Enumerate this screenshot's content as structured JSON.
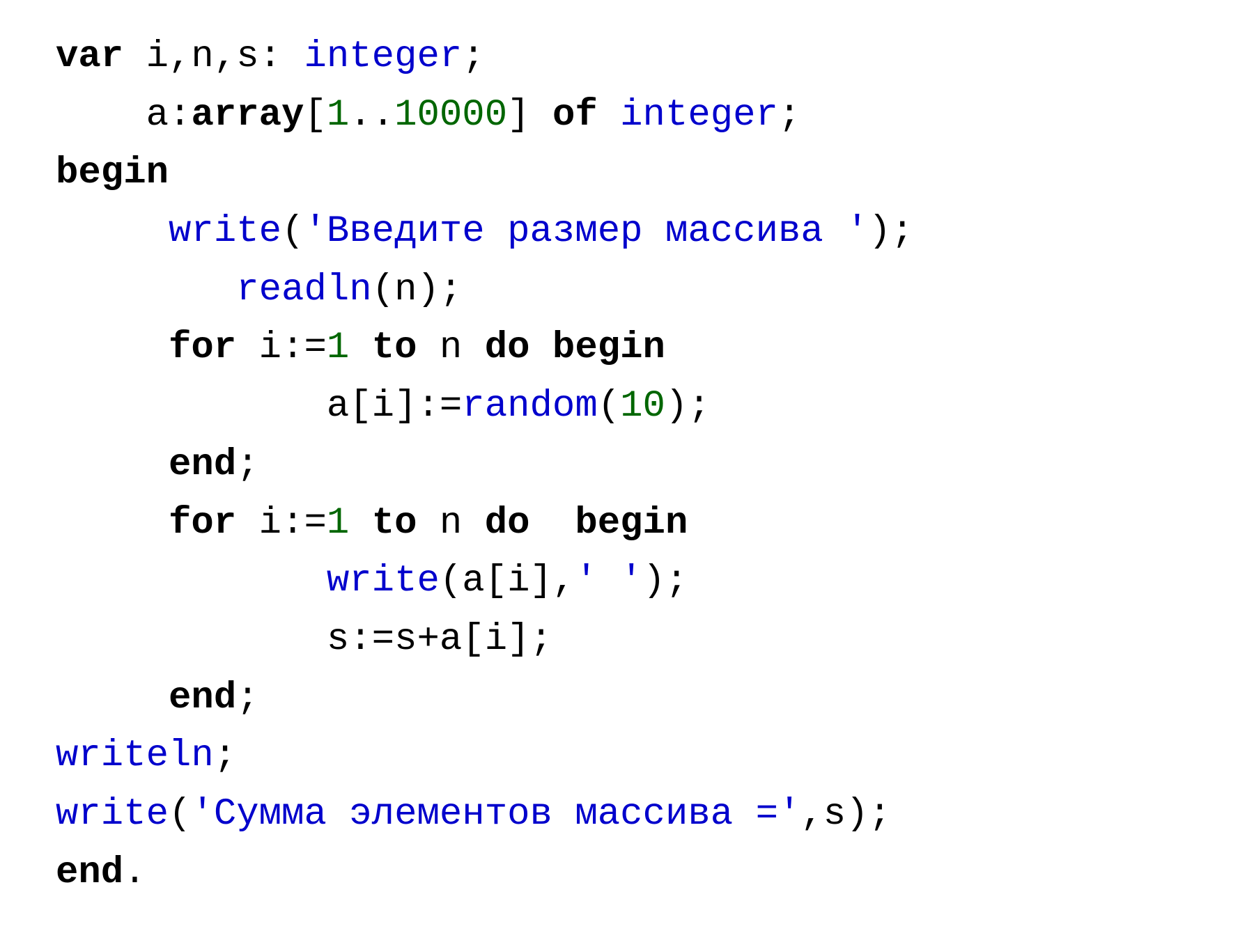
{
  "colors": {
    "keyword": "#000000",
    "type_identifier": "#0000cc",
    "function_call": "#0000cc",
    "number_literal": "#006600",
    "string_literal": "#0000cc",
    "plain": "#000000"
  },
  "code": {
    "language": "Pascal",
    "tokens": [
      [
        {
          "t": "var ",
          "c": "kw"
        },
        {
          "t": "i,n,s: ",
          "c": ""
        },
        {
          "t": "integer",
          "c": "type"
        },
        {
          "t": ";",
          "c": ""
        }
      ],
      [
        {
          "t": "    a:",
          "c": ""
        },
        {
          "t": "array",
          "c": "kw"
        },
        {
          "t": "[",
          "c": ""
        },
        {
          "t": "1",
          "c": "num"
        },
        {
          "t": "..",
          "c": ""
        },
        {
          "t": "10000",
          "c": "num"
        },
        {
          "t": "] ",
          "c": ""
        },
        {
          "t": "of ",
          "c": "kw"
        },
        {
          "t": "integer",
          "c": "type"
        },
        {
          "t": ";",
          "c": ""
        }
      ],
      [
        {
          "t": "begin",
          "c": "kw"
        }
      ],
      [
        {
          "t": "     ",
          "c": ""
        },
        {
          "t": "write",
          "c": "fn"
        },
        {
          "t": "(",
          "c": ""
        },
        {
          "t": "'Введите размер массива '",
          "c": "str"
        },
        {
          "t": ");",
          "c": ""
        }
      ],
      [
        {
          "t": "        ",
          "c": ""
        },
        {
          "t": "readln",
          "c": "fn"
        },
        {
          "t": "(n);",
          "c": ""
        }
      ],
      [
        {
          "t": "     ",
          "c": ""
        },
        {
          "t": "for ",
          "c": "kw"
        },
        {
          "t": "i:=",
          "c": ""
        },
        {
          "t": "1",
          "c": "num"
        },
        {
          "t": " ",
          "c": ""
        },
        {
          "t": "to ",
          "c": "kw"
        },
        {
          "t": "n ",
          "c": ""
        },
        {
          "t": "do begin",
          "c": "kw"
        }
      ],
      [
        {
          "t": "            a[i]:=",
          "c": ""
        },
        {
          "t": "random",
          "c": "fn"
        },
        {
          "t": "(",
          "c": ""
        },
        {
          "t": "10",
          "c": "num"
        },
        {
          "t": ");",
          "c": ""
        }
      ],
      [
        {
          "t": "     ",
          "c": ""
        },
        {
          "t": "end",
          "c": "kw"
        },
        {
          "t": ";",
          "c": ""
        }
      ],
      [
        {
          "t": "     ",
          "c": ""
        },
        {
          "t": "for ",
          "c": "kw"
        },
        {
          "t": "i:=",
          "c": ""
        },
        {
          "t": "1",
          "c": "num"
        },
        {
          "t": " ",
          "c": ""
        },
        {
          "t": "to ",
          "c": "kw"
        },
        {
          "t": "n ",
          "c": ""
        },
        {
          "t": "do  begin",
          "c": "kw"
        }
      ],
      [
        {
          "t": "            ",
          "c": ""
        },
        {
          "t": "write",
          "c": "fn"
        },
        {
          "t": "(a[i],",
          "c": ""
        },
        {
          "t": "' '",
          "c": "str"
        },
        {
          "t": ");",
          "c": ""
        }
      ],
      [
        {
          "t": "            s:=s+a[i];",
          "c": ""
        }
      ],
      [
        {
          "t": "     ",
          "c": ""
        },
        {
          "t": "end",
          "c": "kw"
        },
        {
          "t": ";",
          "c": ""
        }
      ],
      [
        {
          "t": "writeln",
          "c": "fn"
        },
        {
          "t": ";",
          "c": ""
        }
      ],
      [
        {
          "t": "write",
          "c": "fn"
        },
        {
          "t": "(",
          "c": ""
        },
        {
          "t": "'Сумма элементов массива ='",
          "c": "str"
        },
        {
          "t": ",s);",
          "c": ""
        }
      ],
      [
        {
          "t": "end",
          "c": "kw"
        },
        {
          "t": ".",
          "c": ""
        }
      ]
    ]
  }
}
